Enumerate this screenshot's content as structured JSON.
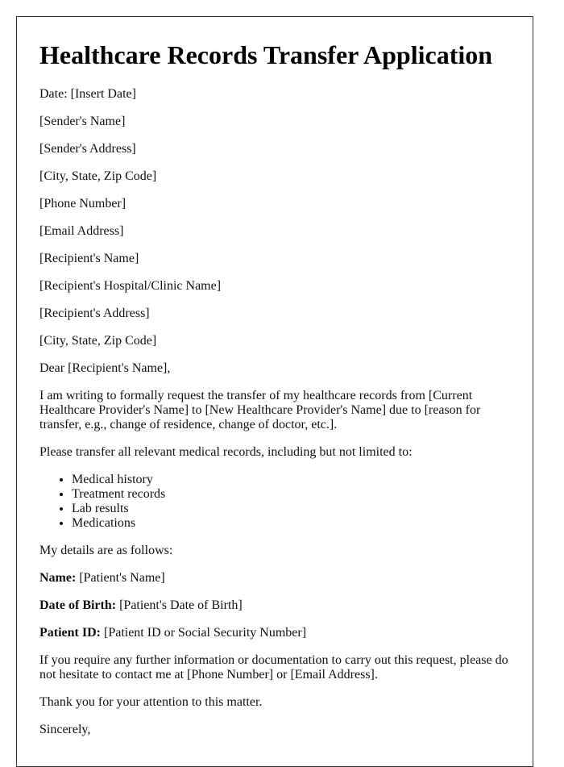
{
  "document": {
    "title": "Healthcare Records Transfer Application",
    "date_line": "Date: [Insert Date]",
    "sender": {
      "name": "[Sender's Name]",
      "address": "[Sender's Address]",
      "city_state_zip": "[City, State, Zip Code]",
      "phone": "[Phone Number]",
      "email": "[Email Address]"
    },
    "recipient": {
      "name": "[Recipient's Name]",
      "hospital": "[Recipient's Hospital/Clinic Name]",
      "address": "[Recipient's Address]",
      "city_state_zip": "[City, State, Zip Code]"
    },
    "salutation": "Dear [Recipient's Name],",
    "intro_paragraph": "I am writing to formally request the transfer of my healthcare records from [Current Healthcare Provider's Name] to [New Healthcare Provider's Name] due to [reason for transfer, e.g., change of residence, change of doctor, etc.].",
    "records_intro": "Please transfer all relevant medical records, including but not limited to:",
    "records_list": [
      "Medical history",
      "Treatment records",
      "Lab results",
      "Medications"
    ],
    "details_intro": "My details are as follows:",
    "details": [
      {
        "label": "Name:",
        "value": " [Patient's Name]"
      },
      {
        "label": "Date of Birth:",
        "value": " [Patient's Date of Birth]"
      },
      {
        "label": "Patient ID:",
        "value": " [Patient ID or Social Security Number]"
      }
    ],
    "contact_paragraph": "If you require any further information or documentation to carry out this request, please do not hesitate to contact me at [Phone Number] or [Email Address].",
    "thanks": "Thank you for your attention to this matter.",
    "closing": "Sincerely,"
  }
}
